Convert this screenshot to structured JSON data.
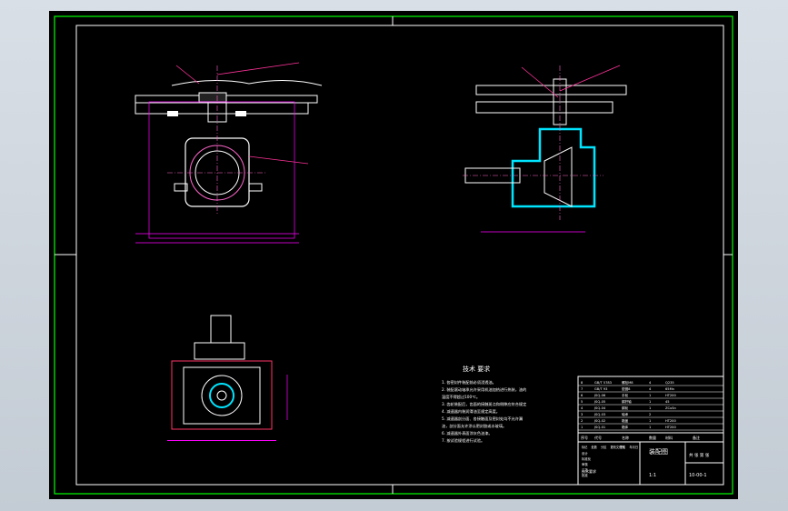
{
  "notes": {
    "title": "技术 要求",
    "lines": [
      "1. 各密封件装配前必须浸透油。",
      "2. 装配滚动轴承允许采用机油加热进行热装，油的",
      "温度不得超过100℃。",
      "3. 齿轮装配后，齿面的接触斑点和侧隙应符合规定",
      "4. 减速器内装润滑油至规定高度。",
      "5. 减速器剖分面、各接触面及密封处均不允许漏",
      "油，剖分面允许涂以密封胶或水玻璃。",
      "6. 减速器外表面涂灰色油漆。",
      "7. 按试验规程进行试验。"
    ]
  },
  "title_block": {
    "drawing_name": "装配图",
    "drawing_no": "10-00-1",
    "scale_label": "1:1",
    "sheet": "共 张 第 张",
    "material_note": "技术要求",
    "sign_cells": [
      "标记",
      "处数",
      "分区",
      "更改文件号",
      "签名",
      "年月日"
    ],
    "design_cells": [
      "设计",
      "标准化",
      "审核",
      "工艺",
      "批准"
    ],
    "bom_header": [
      "序号",
      "代号",
      "名称",
      "数量",
      "材料",
      "备注"
    ],
    "bom_rows": [
      [
        "8",
        "GB/T 5783",
        "螺栓M8",
        "4",
        "Q235",
        ""
      ],
      [
        "7",
        "GB/T 93",
        "垫圈8",
        "4",
        "65Mn",
        ""
      ],
      [
        "6",
        "JSQ-06",
        "手轮",
        "1",
        "HT200",
        ""
      ],
      [
        "5",
        "JSQ-05",
        "蜗杆轴",
        "1",
        "45",
        ""
      ],
      [
        "4",
        "JSQ-04",
        "蜗轮",
        "1",
        "ZCuSn",
        ""
      ],
      [
        "3",
        "JSQ-03",
        "轴承",
        "2",
        "",
        ""
      ],
      [
        "2",
        "JSQ-02",
        "箱盖",
        "1",
        "HT200",
        ""
      ],
      [
        "1",
        "JSQ-01",
        "箱体",
        "1",
        "HT200",
        ""
      ]
    ]
  },
  "colors": {
    "background": "#000000",
    "frame": "#00ff00",
    "geometry": "#ffffff",
    "dimension": "#ff00ff",
    "section_hatch": "#00e5ff",
    "leader": "#ff3399"
  }
}
